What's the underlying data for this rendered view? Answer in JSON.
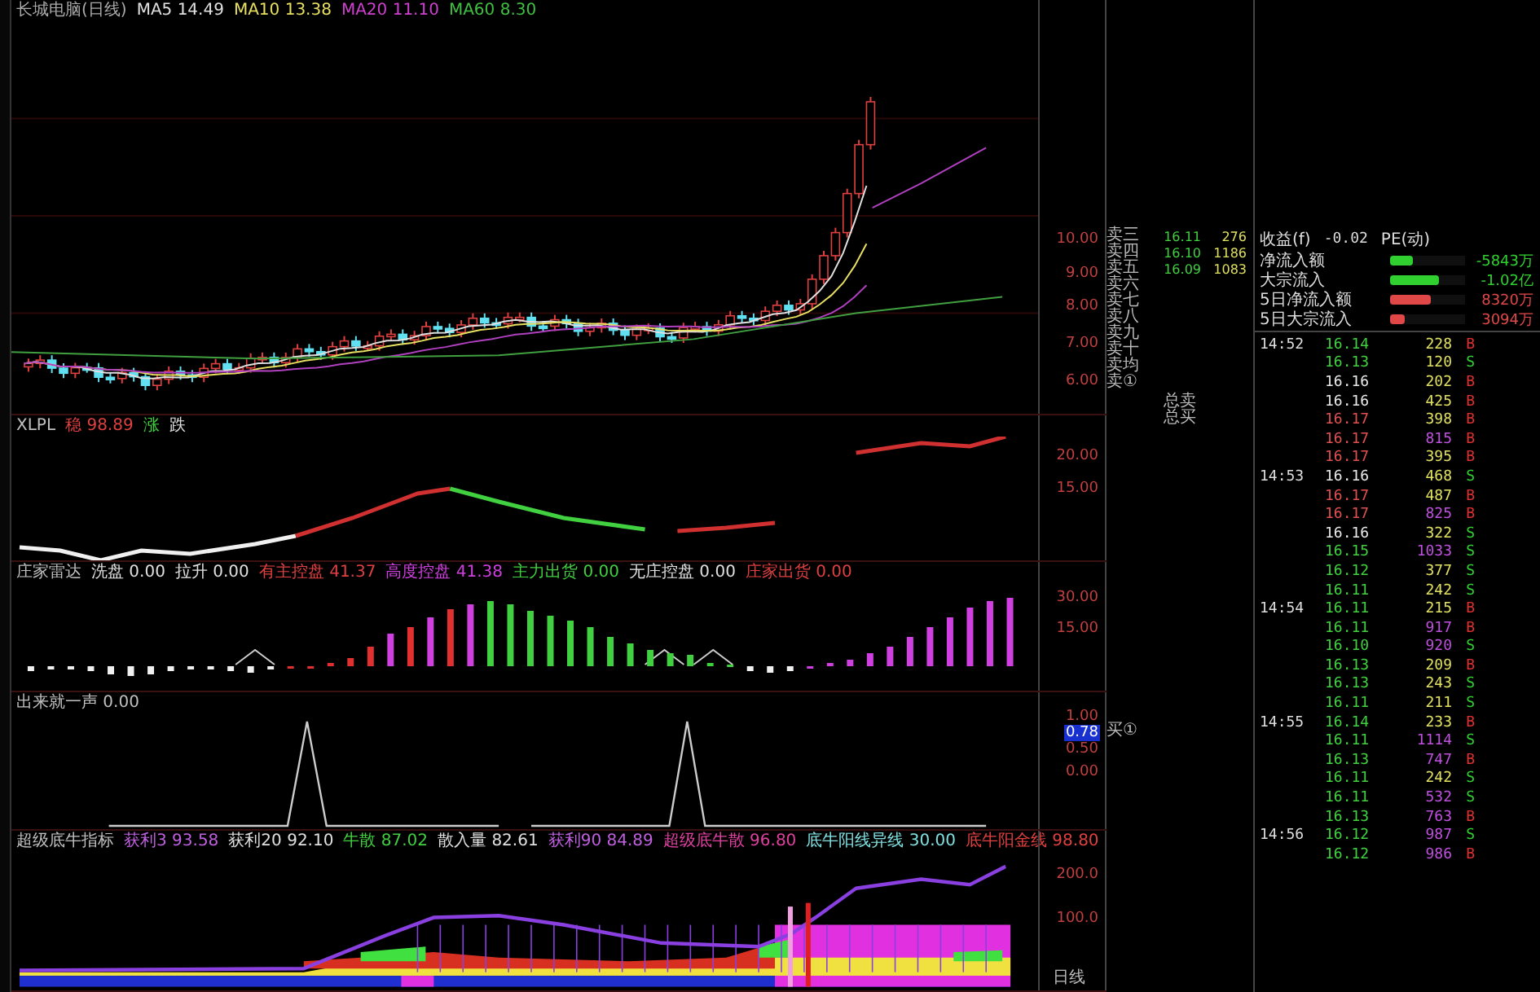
{
  "price_panel": {
    "title": "长城电脑(日线)",
    "legend": [
      {
        "text": "MA5 14.49",
        "color": "#e0e0e0"
      },
      {
        "text": "MA10 13.38",
        "color": "#e8e060"
      },
      {
        "text": "MA20 11.10",
        "color": "#d040d0"
      },
      {
        "text": "MA60 8.30",
        "color": "#40c040"
      }
    ],
    "ticks": [
      "10.00",
      "9.00",
      "8.00",
      "7.00",
      "6.00"
    ]
  },
  "line_panel": {
    "legend": [
      {
        "text": "XLPL",
        "color": "#c0c0c0"
      },
      {
        "text": "稳 98.89",
        "color": "#e04040"
      },
      {
        "text": "涨",
        "color": "#40d040"
      },
      {
        "text": "跌",
        "color": "#e0e0e0"
      }
    ],
    "ticks": [
      "20.00",
      "15.00"
    ]
  },
  "bar_panel": {
    "legend": [
      {
        "text": "庄家雷达",
        "color": "#c0c0c0"
      },
      {
        "text": "洗盘 0.00",
        "color": "#e0e0e0"
      },
      {
        "text": "拉升 0.00",
        "color": "#e0e0e0"
      },
      {
        "text": "有主控盘 41.37",
        "color": "#e04040"
      },
      {
        "text": "高度控盘 41.38",
        "color": "#d040e0"
      },
      {
        "text": "主力出货 0.00",
        "color": "#40d040"
      },
      {
        "text": "无庄控盘 0.00",
        "color": "#e0e0e0"
      },
      {
        "text": "庄家出货 0.00",
        "color": "#e04040"
      }
    ],
    "ticks": [
      "30.00",
      "15.00"
    ]
  },
  "spike_panel": {
    "legend": [
      {
        "text": "出来就一声 0.00",
        "color": "#c0c0c0"
      }
    ],
    "ticks": [
      "1.00",
      "0.78",
      "0.50",
      "0.00"
    ]
  },
  "band_panel": {
    "legend": [
      {
        "text": "超级底牛指标",
        "color": "#c0c0c0"
      },
      {
        "text": "获利3 93.58",
        "color": "#c060e0"
      },
      {
        "text": "获利20 92.10",
        "color": "#e0e0e0"
      },
      {
        "text": "牛散 87.02",
        "color": "#40d040"
      },
      {
        "text": "散入量 82.61",
        "color": "#e0e0e0"
      },
      {
        "text": "获利90 84.89",
        "color": "#c060e0"
      },
      {
        "text": "超级底牛散 96.80",
        "color": "#e040a0"
      },
      {
        "text": "底牛阳线异线 30.00",
        "color": "#80e0e0"
      },
      {
        "text": "底牛阳金线 98.80",
        "color": "#e04040"
      }
    ],
    "ticks": [
      "200.0",
      "100.0"
    ],
    "footer": "日线"
  },
  "order_book": {
    "levels": [
      {
        "label": "卖三",
        "price": "16.11",
        "volume": "276"
      },
      {
        "label": "卖四",
        "price": "16.10",
        "volume": "1186"
      },
      {
        "label": "卖五",
        "price": "16.09",
        "volume": "1083"
      },
      {
        "label": "卖六"
      },
      {
        "label": "卖七"
      },
      {
        "label": "卖八"
      },
      {
        "label": "卖九"
      },
      {
        "label": "卖十"
      },
      {
        "label": "卖均"
      },
      {
        "label": "卖①"
      }
    ],
    "totals": [
      "总卖",
      "总买"
    ],
    "buy_marker": "买①"
  },
  "stats": {
    "label": "收益(f)",
    "value": "-0.02",
    "extra": "PE(动)"
  },
  "flows": [
    {
      "label": "净流入额",
      "level": 0.3,
      "color": "#30d030",
      "value": "-5843万"
    },
    {
      "label": "大宗流入",
      "level": 0.65,
      "color": "#30d030",
      "value": "-1.02亿"
    },
    {
      "label": "5日净流入额",
      "level": 0.55,
      "color": "#e04848",
      "value": "8320万"
    },
    {
      "label": "5日大宗流入",
      "level": 0.2,
      "color": "#e04848",
      "value": "3094万"
    }
  ],
  "ticks": [
    {
      "time": "14:52",
      "price": "16.14",
      "kind": "down",
      "volume": "228",
      "large": false,
      "side": "B",
      "buy": true
    },
    {
      "price": "16.13",
      "kind": "down",
      "volume": "120",
      "large": false,
      "side": "S",
      "buy": false
    },
    {
      "price": "16.16",
      "kind": "flat",
      "volume": "202",
      "large": false,
      "side": "B",
      "buy": true
    },
    {
      "price": "16.16",
      "kind": "flat",
      "volume": "425",
      "large": false,
      "side": "B",
      "buy": true
    },
    {
      "price": "16.17",
      "kind": "up",
      "volume": "398",
      "large": false,
      "side": "B",
      "buy": true
    },
    {
      "price": "16.17",
      "kind": "up",
      "volume": "815",
      "large": true,
      "side": "B",
      "buy": true
    },
    {
      "price": "16.17",
      "kind": "up",
      "volume": "395",
      "large": false,
      "side": "B",
      "buy": true
    },
    {
      "time": "14:53",
      "price": "16.16",
      "kind": "flat",
      "volume": "468",
      "large": false,
      "side": "S",
      "buy": false
    },
    {
      "price": "16.17",
      "kind": "up",
      "volume": "487",
      "large": false,
      "side": "B",
      "buy": true
    },
    {
      "price": "16.17",
      "kind": "up",
      "volume": "825",
      "large": true,
      "side": "B",
      "buy": true
    },
    {
      "price": "16.16",
      "kind": "flat",
      "volume": "322",
      "large": false,
      "side": "S",
      "buy": false
    },
    {
      "price": "16.15",
      "kind": "down",
      "volume": "1033",
      "large": true,
      "side": "S",
      "buy": false
    },
    {
      "price": "16.12",
      "kind": "down",
      "volume": "377",
      "large": false,
      "side": "S",
      "buy": false
    },
    {
      "price": "16.11",
      "kind": "down",
      "volume": "242",
      "large": false,
      "side": "S",
      "buy": false
    },
    {
      "time": "14:54",
      "price": "16.11",
      "kind": "down",
      "volume": "215",
      "large": false,
      "side": "B",
      "buy": true
    },
    {
      "price": "16.11",
      "kind": "down",
      "volume": "917",
      "large": true,
      "side": "B",
      "buy": true
    },
    {
      "price": "16.10",
      "kind": "down",
      "volume": "920",
      "large": true,
      "side": "S",
      "buy": false
    },
    {
      "price": "16.13",
      "kind": "down",
      "volume": "209",
      "large": false,
      "side": "B",
      "buy": true
    },
    {
      "price": "16.13",
      "kind": "down",
      "volume": "243",
      "large": false,
      "side": "S",
      "buy": false
    },
    {
      "price": "16.11",
      "kind": "down",
      "volume": "211",
      "large": false,
      "side": "S",
      "buy": false
    },
    {
      "time": "14:55",
      "price": "16.14",
      "kind": "down",
      "volume": "233",
      "large": false,
      "side": "B",
      "buy": true
    },
    {
      "price": "16.11",
      "kind": "down",
      "volume": "1114",
      "large": true,
      "side": "S",
      "buy": false
    },
    {
      "price": "16.13",
      "kind": "down",
      "volume": "747",
      "large": true,
      "side": "B",
      "buy": true
    },
    {
      "price": "16.11",
      "kind": "down",
      "volume": "242",
      "large": false,
      "side": "S",
      "buy": false
    },
    {
      "price": "16.11",
      "kind": "down",
      "volume": "532",
      "large": true,
      "side": "S",
      "buy": false
    },
    {
      "price": "16.13",
      "kind": "down",
      "volume": "763",
      "large": true,
      "side": "B",
      "buy": true
    },
    {
      "time": "14:56",
      "price": "16.12",
      "kind": "down",
      "volume": "987",
      "large": true,
      "side": "S",
      "buy": false
    },
    {
      "price": "16.12",
      "kind": "down",
      "volume": "986",
      "large": true,
      "side": "B",
      "buy": true
    }
  ]
}
